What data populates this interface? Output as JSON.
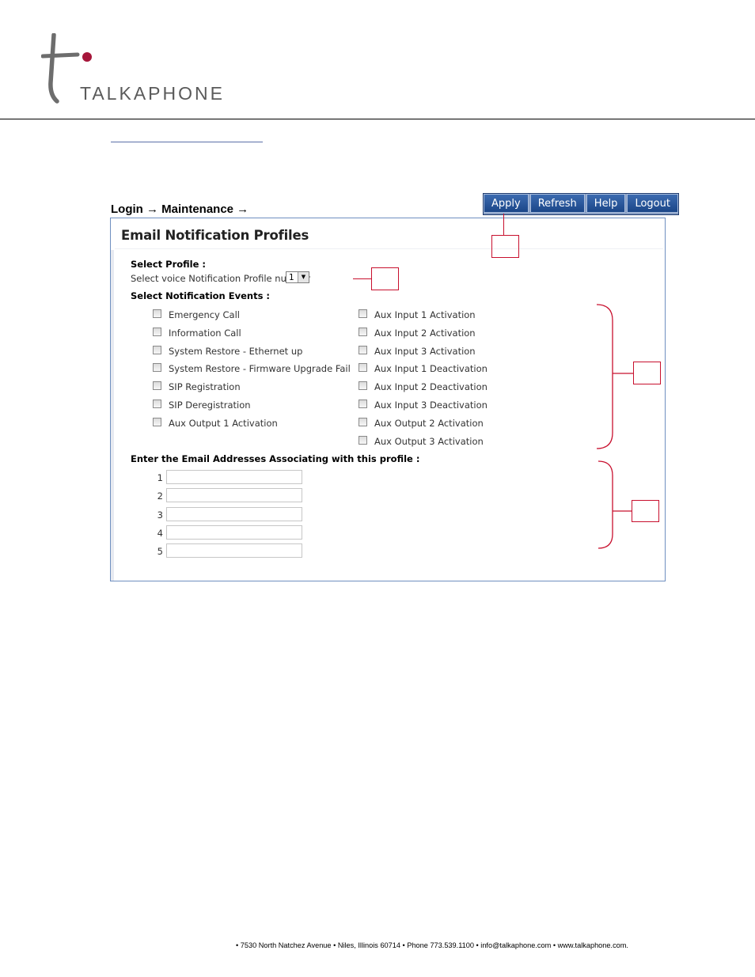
{
  "header": {
    "brand_name": "TALKAPHONE",
    "logo_icon": "talkaphone-t-logo-icon",
    "accent_color": "#a6163a"
  },
  "breadcrumb": "Login → Maintenance →",
  "toolbar": {
    "apply_label": "Apply",
    "refresh_label": "Refresh",
    "help_label": "Help",
    "logout_label": "Logout"
  },
  "panel": {
    "title": "Email Notification Profiles",
    "select_profile_label": "Select Profile :",
    "profile_select_text": "Select voice Notification Profile number",
    "profile_number": "1",
    "events_label": "Select Notification Events :",
    "events_left": [
      "Emergency Call",
      "Information Call",
      "System Restore - Ethernet up",
      "System Restore - Firmware Upgrade Fail",
      "SIP Registration",
      "SIP Deregistration",
      "Aux Output 1 Activation"
    ],
    "events_right": [
      "Aux Input 1 Activation",
      "Aux Input 2 Activation",
      "Aux Input 3 Activation",
      "Aux Input 1 Deactivation",
      "Aux Input 2 Deactivation",
      "Aux Input 3 Deactivation",
      "Aux Output 2 Activation",
      "Aux Output 3 Activation"
    ],
    "emails_label": "Enter the Email Addresses Associating with this profile :",
    "email_numbers": [
      "1",
      "2",
      "3",
      "4",
      "5"
    ]
  },
  "footer": "• 7530 North Natchez Avenue • Niles, Illinois 60714 • Phone 773.539.1100 • info@talkaphone.com • www.talkaphone.com."
}
